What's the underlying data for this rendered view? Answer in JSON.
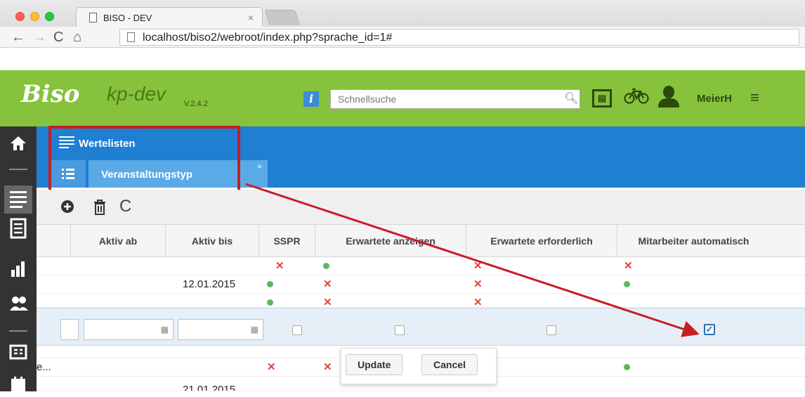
{
  "browser": {
    "tab_title": "BISO - DEV",
    "tab_close": "×",
    "url": "localhost/biso2/webroot/index.php?sprache_id=1#",
    "nav_back": "←",
    "nav_forward": "→",
    "nav_reload": "C",
    "nav_home": "⌂"
  },
  "header": {
    "logo": "Biso",
    "logo_sub": "kp-dev",
    "version": "V.2.4.2",
    "info_glyph": "i",
    "search_placeholder": "Schnellsuche",
    "username": "MeierH",
    "menu_glyph": "≡"
  },
  "panel": {
    "title": "Wertelisten",
    "tab_label": "Veranstaltungstyp",
    "tab_close": "×"
  },
  "toolbar": {
    "add": "⊕",
    "delete": "🗑",
    "refresh": "C"
  },
  "table": {
    "columns": [
      "Aktiv ab",
      "Aktiv bis",
      "SSPR",
      "Erwartete anzeigen",
      "Erwartete erforderlich",
      "Mitarbeiter automatisch"
    ],
    "rows": [
      {
        "aktiv_bis": "",
        "sspr": "x",
        "anzeigen": "ok",
        "erforderlich": "x",
        "mitarbeiter": "x"
      },
      {
        "aktiv_bis": "12.01.2015",
        "sspr": "ok",
        "anzeigen": "x",
        "erforderlich": "x",
        "mitarbeiter": "ok"
      }
    ],
    "row_after": {
      "partial_label": "e...",
      "sspr": "x",
      "anzeigen": "x",
      "mitarbeiter": "ok"
    },
    "row_last": {
      "aktiv_bis": "21.01.2015"
    },
    "checked_glyph": "✓"
  },
  "editor": {
    "update": "Update",
    "cancel": "Cancel"
  },
  "colors": {
    "header_green": "#86c23c",
    "panel_blue": "#1f7fd1",
    "highlight_red": "#c81d23"
  }
}
